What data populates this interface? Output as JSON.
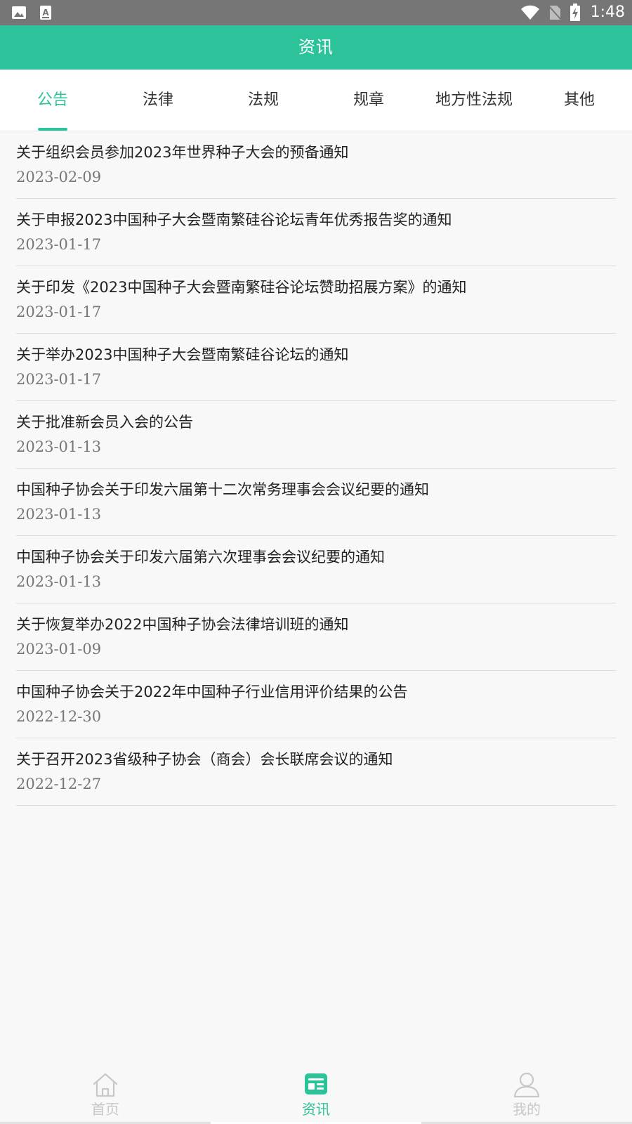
{
  "status_bar": {
    "time": "1:48",
    "icons": [
      "image-icon",
      "a-text-icon",
      "wifi-icon",
      "no-sim-icon",
      "battery-charging-icon"
    ]
  },
  "header": {
    "title": "资讯"
  },
  "tabs": [
    {
      "label": "公告",
      "active": true
    },
    {
      "label": "法律",
      "active": false
    },
    {
      "label": "法规",
      "active": false
    },
    {
      "label": "规章",
      "active": false
    },
    {
      "label": "地方性法规",
      "active": false
    },
    {
      "label": "其他",
      "active": false
    }
  ],
  "list": {
    "items": [
      {
        "title": "关于组织会员参加2023年世界种子大会的预备通知",
        "date": "2023-02-09"
      },
      {
        "title": "关于申报2023中国种子大会暨南繁硅谷论坛青年优秀报告奖的通知",
        "date": "2023-01-17"
      },
      {
        "title": "关于印发《2023中国种子大会暨南繁硅谷论坛赞助招展方案》的通知",
        "date": "2023-01-17"
      },
      {
        "title": "关于举办2023中国种子大会暨南繁硅谷论坛的通知",
        "date": "2023-01-17"
      },
      {
        "title": "关于批准新会员入会的公告",
        "date": "2023-01-13"
      },
      {
        "title": "中国种子协会关于印发六届第十二次常务理事会会议纪要的通知",
        "date": "2023-01-13"
      },
      {
        "title": "中国种子协会关于印发六届第六次理事会会议纪要的通知",
        "date": "2023-01-13"
      },
      {
        "title": "关于恢复举办2022中国种子协会法律培训班的通知",
        "date": "2023-01-09"
      },
      {
        "title": "中国种子协会关于2022年中国种子行业信用评价结果的公告",
        "date": "2022-12-30"
      },
      {
        "title": "关于召开2023省级种子协会（商会）会长联席会议的通知",
        "date": "2022-12-27"
      }
    ]
  },
  "bottom_nav": [
    {
      "label": "首页",
      "icon": "home-icon",
      "active": false
    },
    {
      "label": "资讯",
      "icon": "news-icon",
      "active": true
    },
    {
      "label": "我的",
      "icon": "user-icon",
      "active": false
    }
  ],
  "colors": {
    "accent": "#2cc39b",
    "status_bar": "#767676",
    "inactive_nav": "#c8c8c8",
    "date_text": "#777777"
  }
}
